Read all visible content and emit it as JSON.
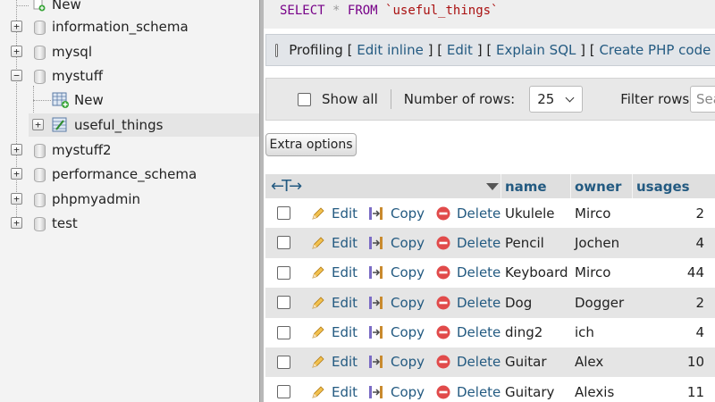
{
  "navigation": {
    "top_new": "New",
    "databases": [
      {
        "name": "information_schema"
      },
      {
        "name": "mysql"
      },
      {
        "name": "mystuff",
        "expanded": true
      },
      {
        "name": "mystuff2"
      },
      {
        "name": "performance_schema"
      },
      {
        "name": "phpmyadmin"
      },
      {
        "name": "test"
      }
    ],
    "mystuff_children": {
      "new": "New",
      "table": "useful_things"
    }
  },
  "query": {
    "keyword_select": "SELECT",
    "star": "*",
    "keyword_from": "FROM",
    "table": "`useful_things`"
  },
  "profiling": {
    "label": "Profiling",
    "open": "[",
    "close": "]",
    "links": [
      "Edit inline",
      "Edit",
      "Explain SQL",
      "Create PHP code"
    ]
  },
  "navbar": {
    "show_all": "Show all",
    "number_of_rows": "Number of rows:",
    "rows_value": "25",
    "filter_rows": "Filter rows:",
    "filter_placeholder": "Search this table"
  },
  "extra_options": "Extra options",
  "table": {
    "arrows": "←T→",
    "columns": [
      "name",
      "owner",
      "usages"
    ],
    "actions": {
      "edit": "Edit",
      "copy": "Copy",
      "delete": "Delete"
    },
    "rows": [
      {
        "name": "Ukulele",
        "owner": "Mirco",
        "usages": "2"
      },
      {
        "name": "Pencil",
        "owner": "Jochen",
        "usages": "4"
      },
      {
        "name": "Keyboard",
        "owner": "Mirco",
        "usages": "44"
      },
      {
        "name": "Dog",
        "owner": "Dogger",
        "usages": "2"
      },
      {
        "name": "ding2",
        "owner": "ich",
        "usages": "4"
      },
      {
        "name": "Guitar",
        "owner": "Alex",
        "usages": "10"
      },
      {
        "name": "Guitary",
        "owner": "Alexis",
        "usages": "11"
      }
    ]
  },
  "colors": {
    "link": "#235a81",
    "sql_keyword": "#770088",
    "sql_string": "#aa1111",
    "row_alt": "#e5e5e5",
    "nav_bg": "#f3f3f3"
  }
}
